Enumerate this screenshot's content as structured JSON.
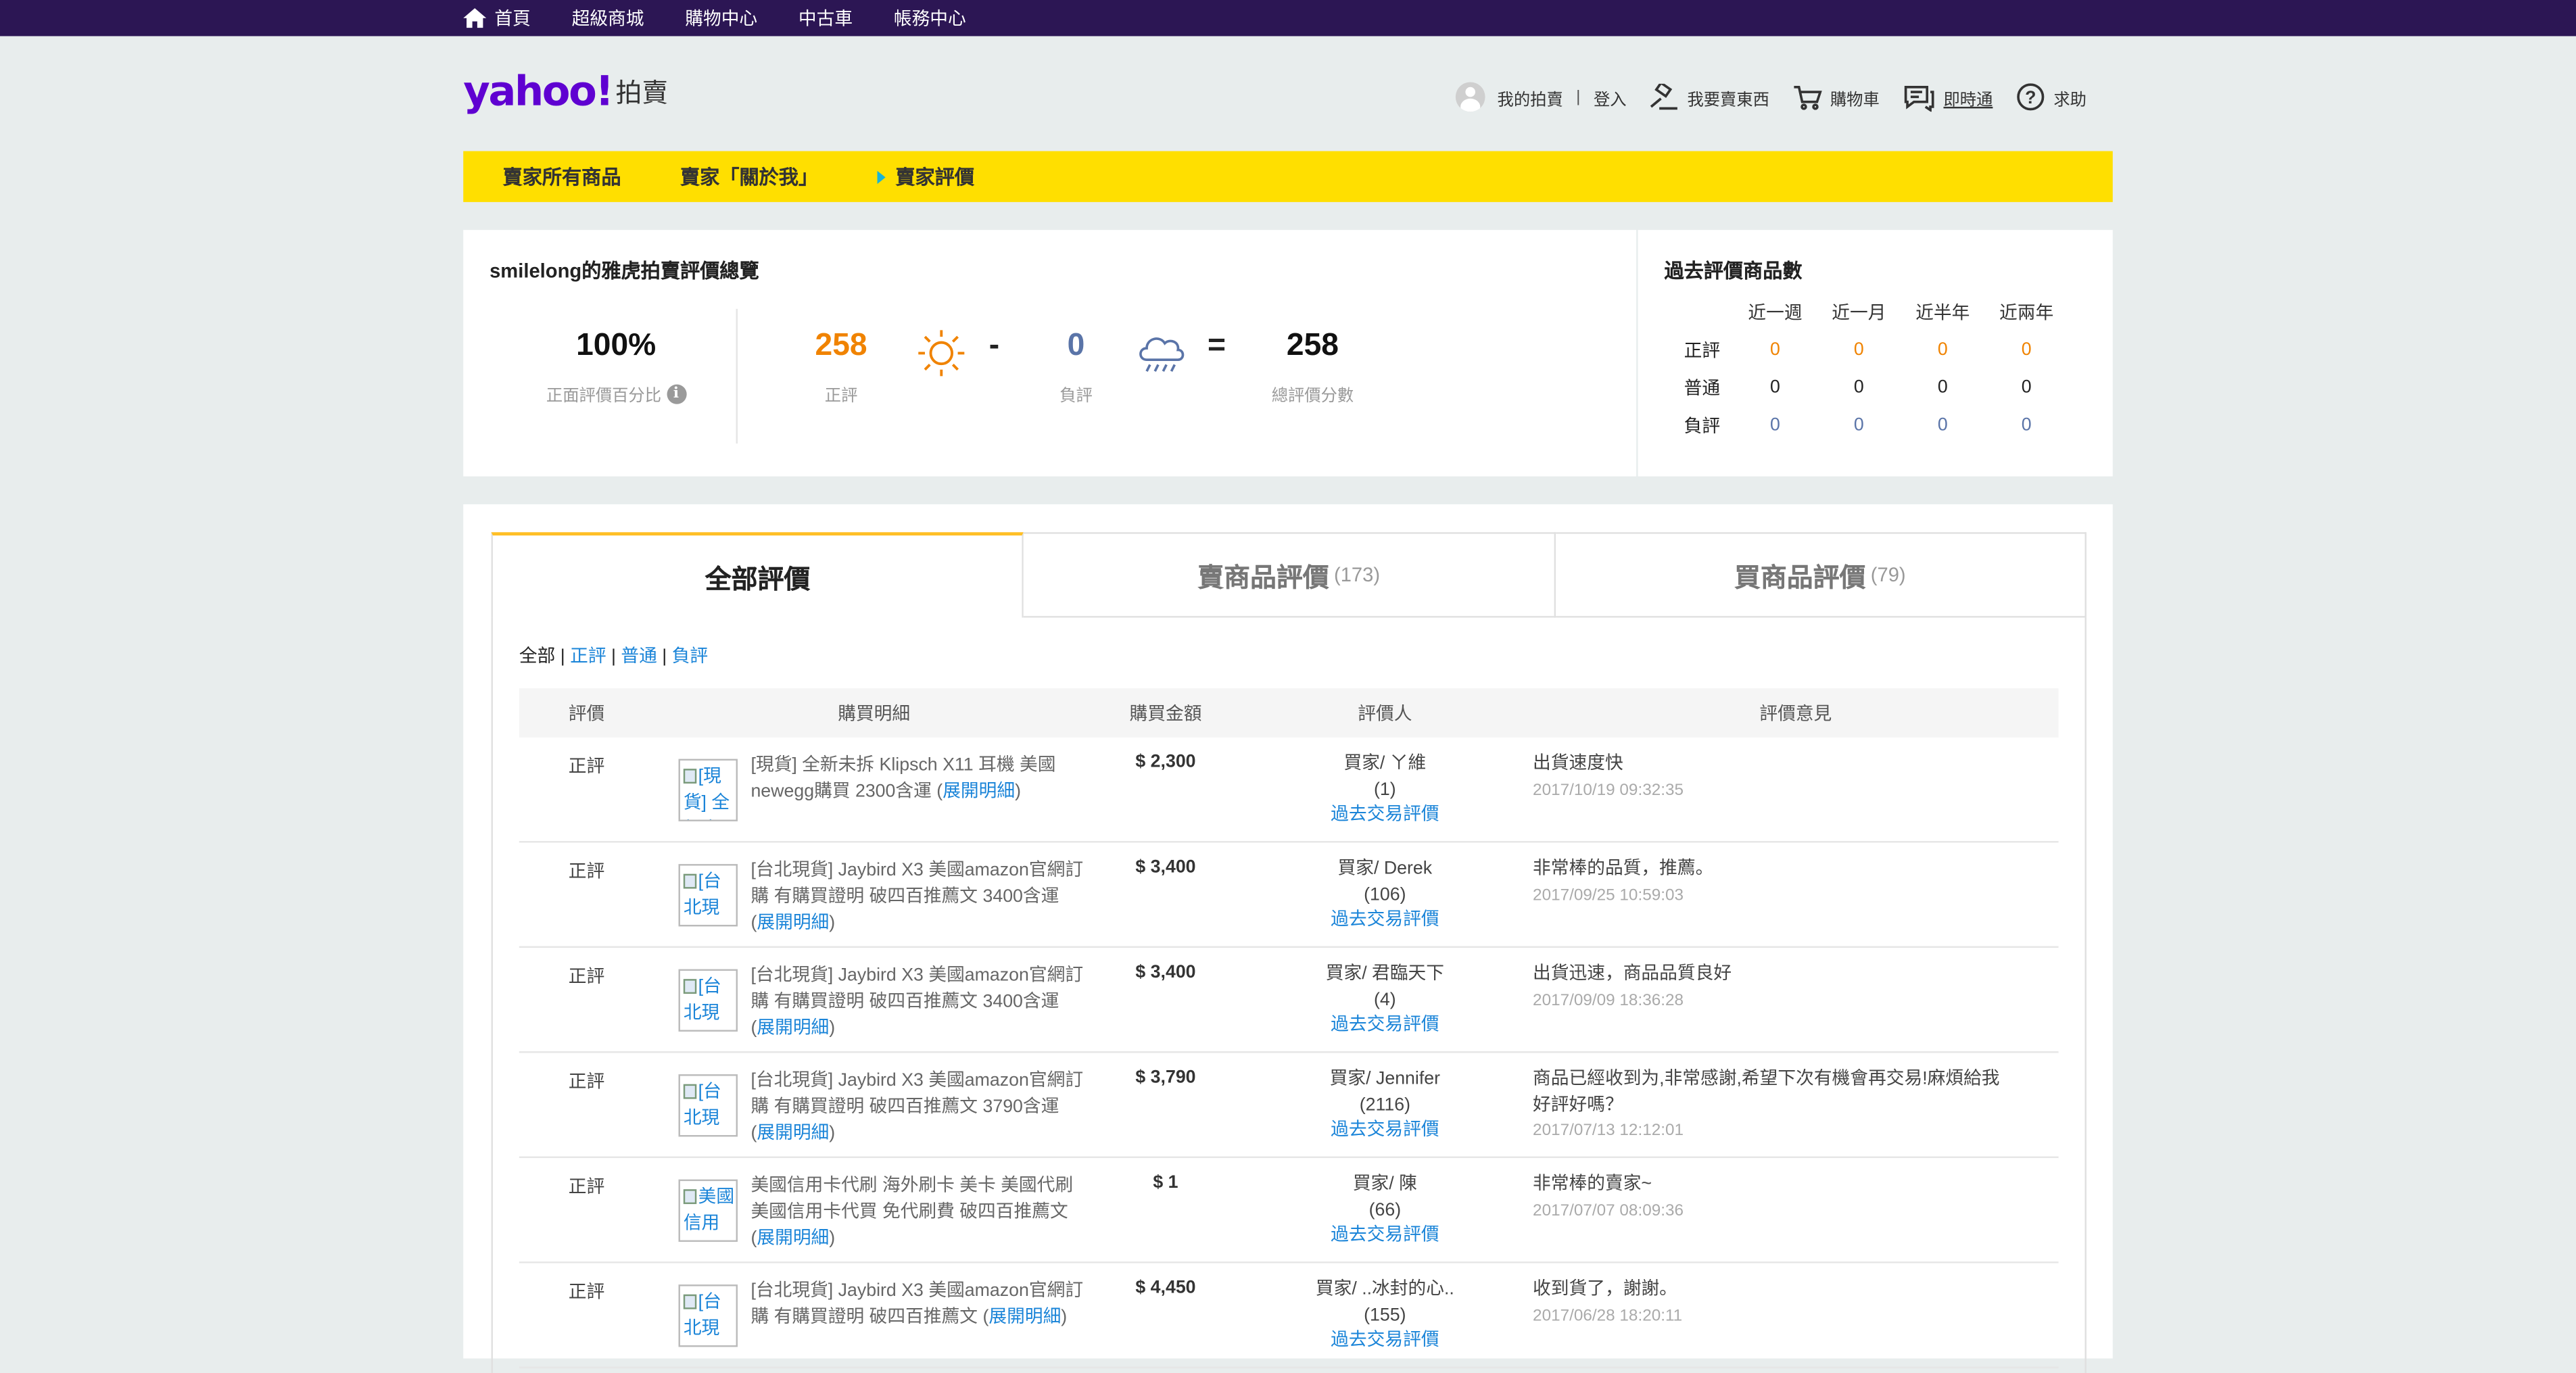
{
  "topnav": {
    "items": [
      "首頁",
      "超級商城",
      "購物中心",
      "中古車",
      "帳務中心"
    ]
  },
  "logo": {
    "wordmark": "yahoo!",
    "subtitle": "拍賣"
  },
  "utils": {
    "my_auction": "我的拍賣",
    "separator": "|",
    "login": "登入",
    "sell": "我要賣東西",
    "cart": "購物車",
    "messenger": "即時通",
    "help": "求助"
  },
  "yellow_nav": {
    "items": [
      "賣家所有商品",
      "賣家「關於我」",
      "賣家評價"
    ],
    "active_index": 2
  },
  "summary": {
    "title": "smilelong的雅虎拍賣評價總覽",
    "positive_percent": "100%",
    "positive_percent_label": "正面評價百分比",
    "positive": "258",
    "positive_label": "正評",
    "minus": "-",
    "negative": "0",
    "negative_label": "負評",
    "equals": "=",
    "total": "258",
    "total_label": "總評價分數"
  },
  "past": {
    "title": "過去評價商品數",
    "columns": [
      "近一週",
      "近一月",
      "近半年",
      "近兩年"
    ],
    "rows": [
      {
        "label": "正評",
        "values": [
          "0",
          "0",
          "0",
          "0"
        ],
        "color": "#f08300"
      },
      {
        "label": "普通",
        "values": [
          "0",
          "0",
          "0",
          "0"
        ],
        "color": "#222222"
      },
      {
        "label": "負評",
        "values": [
          "0",
          "0",
          "0",
          "0"
        ],
        "color": "#5a74a8"
      }
    ]
  },
  "tabs": [
    {
      "label": "全部評價",
      "count": ""
    },
    {
      "label": "賣商品評價",
      "count": "(173)"
    },
    {
      "label": "買商品評價",
      "count": "(79)"
    }
  ],
  "filter": {
    "all": "全部",
    "sep": "|",
    "positive": "正評",
    "neutral": "普通",
    "negative": "負評"
  },
  "table": {
    "headers": [
      "評價",
      "購買明細",
      "購買金額",
      "評價人",
      "評價意見"
    ],
    "rows": [
      {
        "rating": "正評",
        "thumb": "[現貨] 全新未拆",
        "desc": "[現貨] 全新未拆 Klipsch X11 耳機 美國newegg購買 2300含運 (",
        "expand": "展開明細",
        "close": ")",
        "amount": "$ 2,300",
        "rater": "買家/ ㄚ維",
        "rater_count": "(1)",
        "rater_link": "過去交易評價",
        "comment": "出貨速度快",
        "date": "2017/10/19 09:32:35"
      },
      {
        "rating": "正評",
        "thumb": "[台北現",
        "desc": "[台北現貨] Jaybird X3 美國amazon官網訂購 有購買證明 破四百推薦文 3400含運 (",
        "expand": "展開明細",
        "close": ")",
        "amount": "$ 3,400",
        "rater": "買家/ Derek",
        "rater_count": "(106)",
        "rater_link": "過去交易評價",
        "comment": "非常棒的品質，推薦。",
        "date": "2017/09/25 10:59:03"
      },
      {
        "rating": "正評",
        "thumb": "[台北現",
        "desc": "[台北現貨] Jaybird X3 美國amazon官網訂購 有購買證明 破四百推薦文 3400含運 (",
        "expand": "展開明細",
        "close": ")",
        "amount": "$ 3,400",
        "rater": "買家/ 君臨天下",
        "rater_count": "(4)",
        "rater_link": "過去交易評價",
        "comment": "出貨迅速，商品品質良好",
        "date": "2017/09/09 18:36:28"
      },
      {
        "rating": "正評",
        "thumb": "[台北現",
        "desc": "[台北現貨] Jaybird X3 美國amazon官網訂購 有購買證明 破四百推薦文 3790含運 (",
        "expand": "展開明細",
        "close": ")",
        "amount": "$ 3,790",
        "rater": "買家/ Jennifer",
        "rater_count": "(2116)",
        "rater_link": "過去交易評價",
        "comment": "商品已經收到为,非常感謝,希望下次有機會再交易!麻煩給我好評好嗎？",
        "date": "2017/07/13 12:12:01"
      },
      {
        "rating": "正評",
        "thumb": "美國信用",
        "desc": "美國信用卡代刷 海外刷卡 美卡 美國代刷 美國信用卡代買 免代刷費 破四百推薦文 (",
        "expand": "展開明細",
        "close": ")",
        "amount": "$ 1",
        "rater": "買家/ 陳",
        "rater_count": "(66)",
        "rater_link": "過去交易評價",
        "comment": "非常棒的賣家~",
        "date": "2017/07/07 08:09:36"
      },
      {
        "rating": "正評",
        "thumb": "[台北現",
        "desc": "[台北現貨] Jaybird X3 美國amazon官網訂購 有購買證明 破四百推薦文 (",
        "expand": "展開明細",
        "close": ")",
        "amount": "$ 4,450",
        "rater": "買家/ ..冰封的心..",
        "rater_count": "(155)",
        "rater_link": "過去交易評價",
        "comment": "收到貨了，謝謝。",
        "date": "2017/06/28 18:20:11"
      }
    ]
  },
  "colors": {
    "topbar": "#2c1654",
    "brand_purple": "#5f01d1",
    "yellow_nav": "#ffdf00",
    "positive_orange": "#f08300",
    "negative_blue": "#5a74a8",
    "link_blue": "#1a84d8",
    "tab_accent": "#ffbf25"
  },
  "icons": {
    "home": "home-icon",
    "user": "user-avatar-icon",
    "sell": "gavel-icon",
    "cart": "cart-icon",
    "messenger": "chat-icon",
    "help": "help-icon",
    "sun": "sun-icon",
    "rain": "rain-cloud-icon",
    "info": "info-icon"
  }
}
